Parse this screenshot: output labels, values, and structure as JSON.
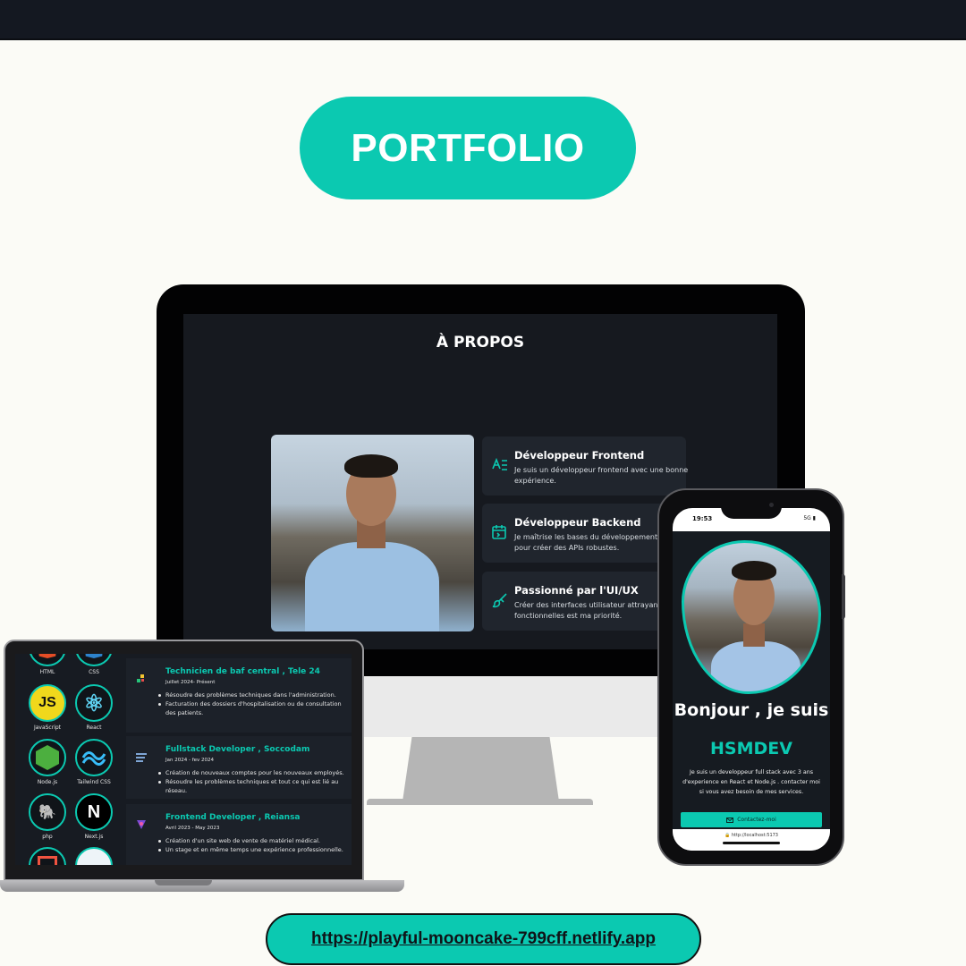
{
  "header": {
    "title": "PORTFOLIO"
  },
  "colors": {
    "accent": "#0bc9b1",
    "dark": "#16191f",
    "card": "#20252d"
  },
  "desktop": {
    "section_title": "À PROPOS",
    "cards": [
      {
        "icon": "frontend-code-icon",
        "title": "Développeur Frontend",
        "text": "Je suis un développeur frontend avec une bonne expérience."
      },
      {
        "icon": "backend-calendar-icon",
        "title": "Développeur Backend",
        "text": "Je maîtrise les bases du développement backend pour créer des APIs robustes."
      },
      {
        "icon": "paintbrush-icon",
        "title": "Passionné par l'UI/UX",
        "text": "Créer des interfaces utilisateur attrayantes et fonctionnelles est ma priorité."
      }
    ]
  },
  "laptop": {
    "skills": [
      {
        "label": "HTML",
        "icon": "html-icon"
      },
      {
        "label": "CSS",
        "icon": "css-icon"
      },
      {
        "label": "JavaScript",
        "icon": "javascript-icon",
        "glyph": "JS"
      },
      {
        "label": "React",
        "icon": "react-icon",
        "glyph": "⚛"
      },
      {
        "label": "Node.js",
        "icon": "nodejs-icon"
      },
      {
        "label": "Tailwind CSS",
        "icon": "tailwind-icon"
      },
      {
        "label": "php",
        "icon": "php-icon",
        "glyph": "🐘"
      },
      {
        "label": "Next.js",
        "icon": "nextjs-icon",
        "glyph": "N"
      }
    ],
    "experiences": [
      {
        "title": "Technicien de baf central , Tele 24",
        "date": "Juillet 2024- Présent",
        "bullets": [
          "Résoudre des problèmes techniques dans l'administration.",
          "Facturation des dossiers d'hospitalisation ou de consultation des patients."
        ]
      },
      {
        "title": "Fullstack Developer , Soccodam",
        "date": "Jan 2024 - fev 2024",
        "bullets": [
          "Création de nouveaux comptes pour les nouveaux employés.",
          "Résoudre les problèmes techniques et tout ce qui est lié au réseau."
        ]
      },
      {
        "title": "Frontend Developer , Reiansa",
        "date": "Avril 2023 - May 2023",
        "bullets": [
          "Création d'un site web de vente de matériel médical.",
          "Un stage et en même temps une expérience professionnelle."
        ]
      }
    ]
  },
  "phone": {
    "status_time": "19:53",
    "status_right": "5G ▮",
    "greeting": "Bonjour , je suis",
    "name": "HSMDEV",
    "description": "Je suis un developpeur full stack avec 3 ans d'experience en React et Node.js . contacter moi si vous avez besoin de mes services.",
    "cta_label": "Contactez-moi",
    "browser_url": "🔒 http://localhost:5173"
  },
  "footer": {
    "url": "https://playful-mooncake-799cff.netlify.app"
  }
}
